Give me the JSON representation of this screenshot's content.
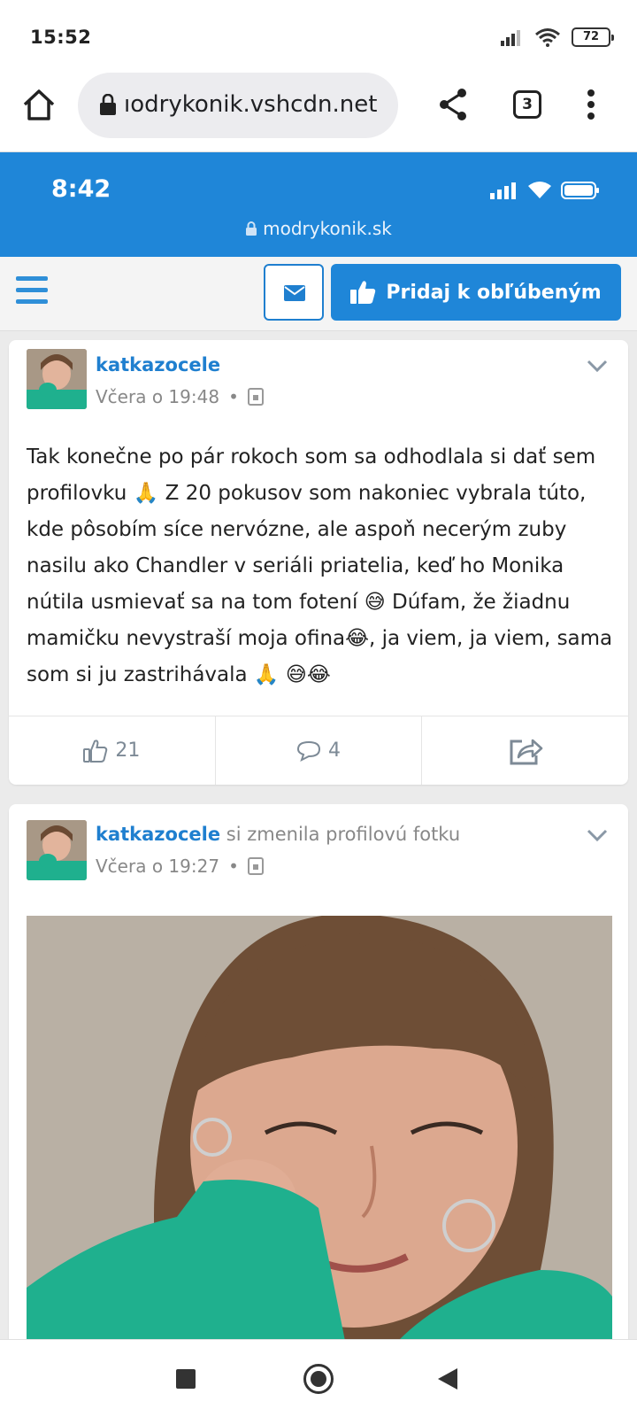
{
  "status_bar": {
    "time": "15:52",
    "battery": "72"
  },
  "browser": {
    "url": "ıodrykonik.vshcdn.net",
    "tab_count": "3"
  },
  "inner_status": {
    "time": "8:42",
    "url": "modrykonik.sk"
  },
  "navbar": {
    "favorite_label": "Pridaj k obľúbeným"
  },
  "posts": [
    {
      "author": "katkazocele",
      "action": "",
      "time": "Včera o 19:48",
      "separator": "•",
      "text": "Tak konečne po pár rokoch som sa odhodlala si dať sem profilovku 🙏 Z 20 pokusov som nakoniec vybrala túto, kde pôsobím síce nervózne, ale aspoň necerým zuby nasilu ako Chandler v seriáli priatelia, keď ho Monika nútila usmievať sa na tom fotení 😅 Dúfam, že žiadnu mamičku nevystraší moja ofina😂, ja viem, ja viem, sama som si ju zastrihávala 🙏 😅😂",
      "likes": "21",
      "comments": "4"
    },
    {
      "author": "katkazocele",
      "action": "si zmenila profilovú fotku",
      "time": "Včera o 19:27",
      "separator": "•"
    }
  ],
  "colors": {
    "brand_blue": "#1f86d8",
    "link_blue": "#1f7fcf",
    "photo_sweater": "#1fb08e"
  }
}
